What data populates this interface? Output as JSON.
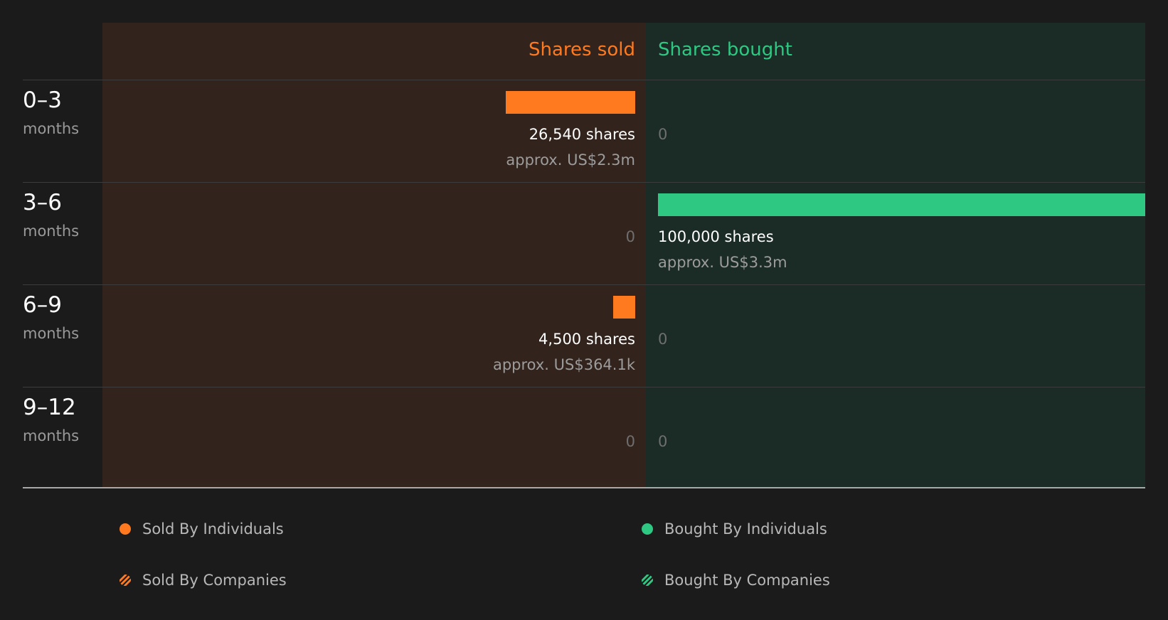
{
  "columns": {
    "sold_title": "Shares sold",
    "bought_title": "Shares bought"
  },
  "rows": [
    {
      "range": "0–3",
      "unit": "months",
      "sold": {
        "shares_text": "26,540 shares",
        "approx_text": "approx. US$2.3m",
        "zero_text": ""
      },
      "bought": {
        "shares_text": "",
        "approx_text": "",
        "zero_text": "0"
      }
    },
    {
      "range": "3–6",
      "unit": "months",
      "sold": {
        "shares_text": "",
        "approx_text": "",
        "zero_text": "0"
      },
      "bought": {
        "shares_text": "100,000 shares",
        "approx_text": "approx. US$3.3m",
        "zero_text": ""
      }
    },
    {
      "range": "6–9",
      "unit": "months",
      "sold": {
        "shares_text": "4,500 shares",
        "approx_text": "approx. US$364.1k",
        "zero_text": ""
      },
      "bought": {
        "shares_text": "",
        "approx_text": "",
        "zero_text": "0"
      }
    },
    {
      "range": "9–12",
      "unit": "months",
      "sold": {
        "shares_text": "",
        "approx_text": "",
        "zero_text": "0"
      },
      "bought": {
        "shares_text": "",
        "approx_text": "",
        "zero_text": "0"
      }
    }
  ],
  "legend": [
    {
      "label": "Sold By Individuals",
      "color": "#ff7a1f",
      "style": "solid"
    },
    {
      "label": "Bought By Individuals",
      "color": "#2ec882",
      "style": "solid"
    },
    {
      "label": "Sold By Companies",
      "color": "#ff7a1f",
      "style": "hatched"
    },
    {
      "label": "Bought By Companies",
      "color": "#2ec882",
      "style": "hatched"
    }
  ],
  "colors": {
    "sold": "#ff7a1f",
    "bought": "#2ec882",
    "sold_panel": "#32231c",
    "bought_panel": "#1b2b25",
    "background": "#1b1b1b"
  },
  "chart_data": {
    "type": "bar",
    "categories": [
      "0–3 months",
      "3–6 months",
      "6–9 months",
      "9–12 months"
    ],
    "series": [
      {
        "name": "Shares sold",
        "values": [
          26540,
          0,
          4500,
          0
        ]
      },
      {
        "name": "Shares bought",
        "values": [
          0,
          100000,
          0,
          0
        ]
      }
    ],
    "approx_value_usd": {
      "sold": [
        "approx. US$2.3m",
        null,
        "approx. US$364.1k",
        null
      ],
      "bought": [
        null,
        "approx. US$3.3m",
        null,
        null
      ]
    },
    "legend": [
      "Sold By Individuals",
      "Bought By Individuals",
      "Sold By Companies",
      "Bought By Companies"
    ],
    "legend_position": "bottom",
    "grid": false
  }
}
